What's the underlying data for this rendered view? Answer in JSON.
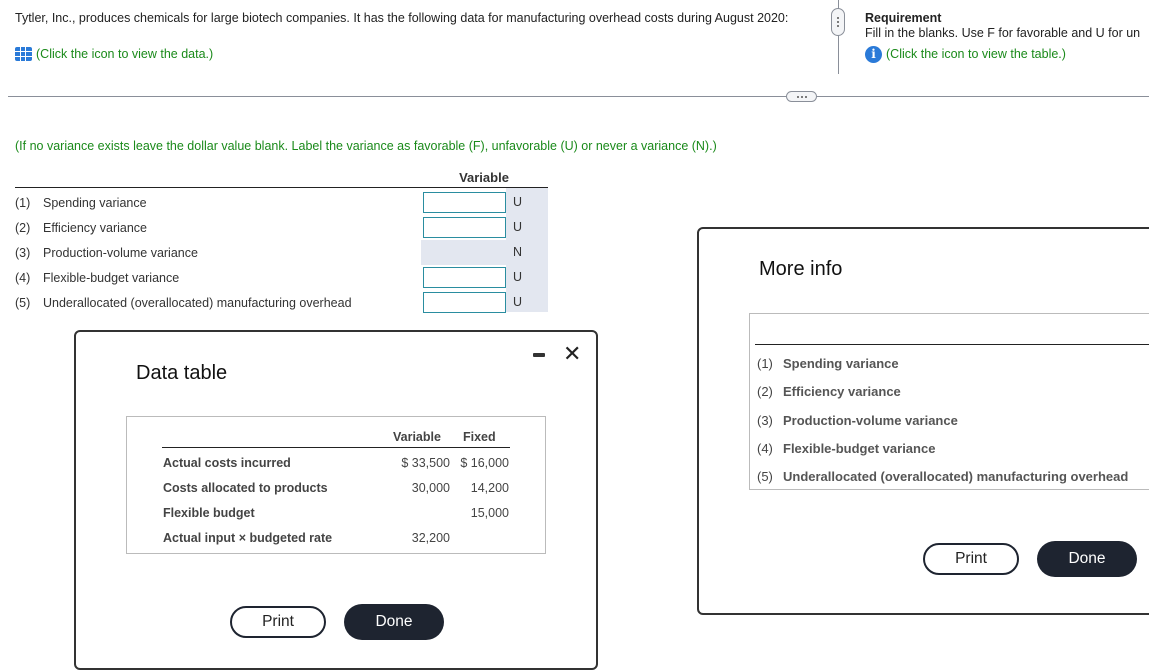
{
  "question": {
    "intro": "Tytler, Inc., produces chemicals for large biotech companies. It has the following data for manufacturing overhead costs during August 2020:",
    "data_link": "(Click the icon to view the data.)",
    "data_icon": "grid-table-icon"
  },
  "requirement": {
    "title": "Requirement",
    "text": "Fill in the blanks. Use F for favorable and U for un",
    "table_link": "(Click the icon to view the table.)",
    "info_icon": "i"
  },
  "answer": {
    "instruction": "(If no variance exists leave the dollar value blank. Label the variance as favorable (F), unfavorable (U) or never a variance (N).)",
    "column_header": "Variable",
    "rows": [
      {
        "num": "(1)",
        "label": "Spending variance",
        "value": "",
        "input": true,
        "letter": "U"
      },
      {
        "num": "(2)",
        "label": "Efficiency variance",
        "value": "",
        "input": true,
        "letter": "U"
      },
      {
        "num": "(3)",
        "label": "Production-volume variance",
        "value": "",
        "input": false,
        "letter": "N"
      },
      {
        "num": "(4)",
        "label": "Flexible-budget variance",
        "value": "",
        "input": true,
        "letter": "U"
      },
      {
        "num": "(5)",
        "label": "Underallocated (overallocated) manufacturing overhead",
        "value": "",
        "input": true,
        "letter": "U"
      }
    ]
  },
  "data_table_modal": {
    "title": "Data table",
    "headers": [
      "Variable",
      "Fixed"
    ],
    "rows": [
      {
        "label": "Actual costs incurred",
        "variable": "$  33,500",
        "fixed": "$  16,000"
      },
      {
        "label": "Costs allocated to products",
        "variable": "30,000",
        "fixed": "14,200"
      },
      {
        "label": "Flexible budget",
        "variable": "",
        "fixed": "15,000"
      },
      {
        "label": "Actual input × budgeted rate",
        "variable": "32,200",
        "fixed": ""
      }
    ],
    "print_label": "Print",
    "done_label": "Done",
    "minimize_symbol": "–",
    "close_symbol": "✕"
  },
  "more_info_modal": {
    "title": "More info",
    "rows": [
      {
        "num": "(1)",
        "label": "Spending variance"
      },
      {
        "num": "(2)",
        "label": "Efficiency variance"
      },
      {
        "num": "(3)",
        "label": "Production-volume variance"
      },
      {
        "num": "(4)",
        "label": "Flexible-budget variance"
      },
      {
        "num": "(5)",
        "label": "Underallocated (overallocated) manufacturing overhead"
      }
    ],
    "print_label": "Print",
    "done_label": "Done"
  }
}
